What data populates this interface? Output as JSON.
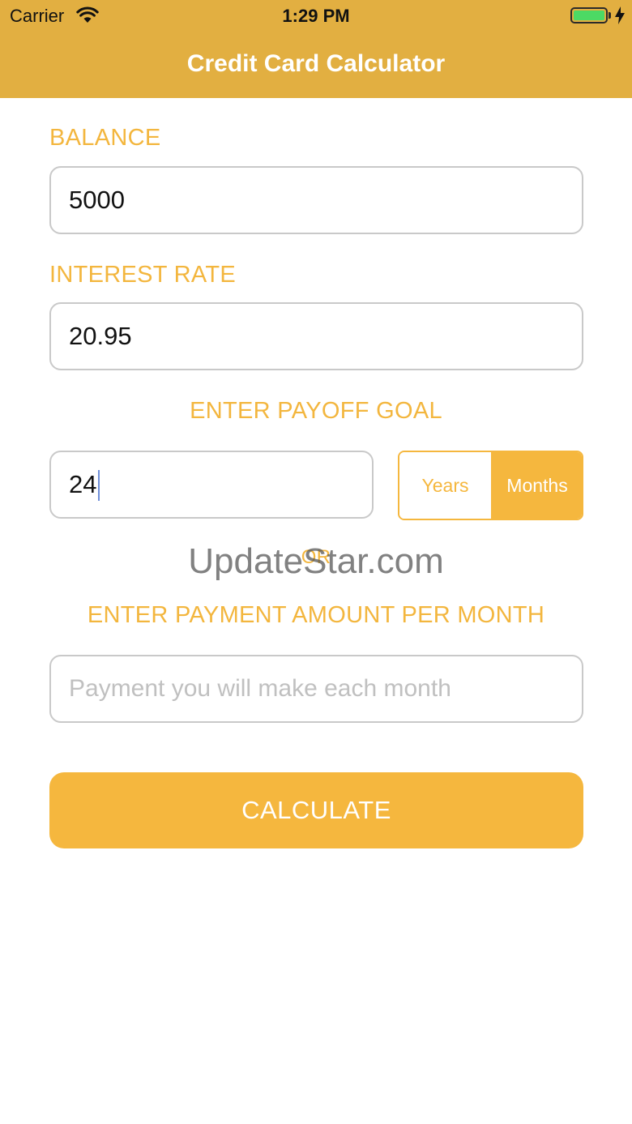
{
  "status_bar": {
    "carrier": "Carrier",
    "time": "1:29 PM"
  },
  "nav": {
    "title": "Credit Card Calculator"
  },
  "form": {
    "balance_label": "BALANCE",
    "balance_value": "5000",
    "interest_label": "INTEREST RATE",
    "interest_value": "20.95",
    "payoff_goal_label": "ENTER PAYOFF GOAL",
    "payoff_goal_value": "24",
    "period_options": [
      "Years",
      "Months"
    ],
    "period_selected": "Months",
    "or_label": "OR",
    "payment_label": "ENTER PAYMENT AMOUNT PER MONTH",
    "payment_placeholder": "Payment you will make each month",
    "calculate_label": "CALCULATE"
  },
  "watermark": "UpdateStar.com",
  "colors": {
    "nav_bar": "#E2AF41",
    "accent": "#F5B73E",
    "battery": "#4CD964"
  },
  "icons": [
    "wifi-icon",
    "battery-icon",
    "charging-bolt-icon"
  ]
}
